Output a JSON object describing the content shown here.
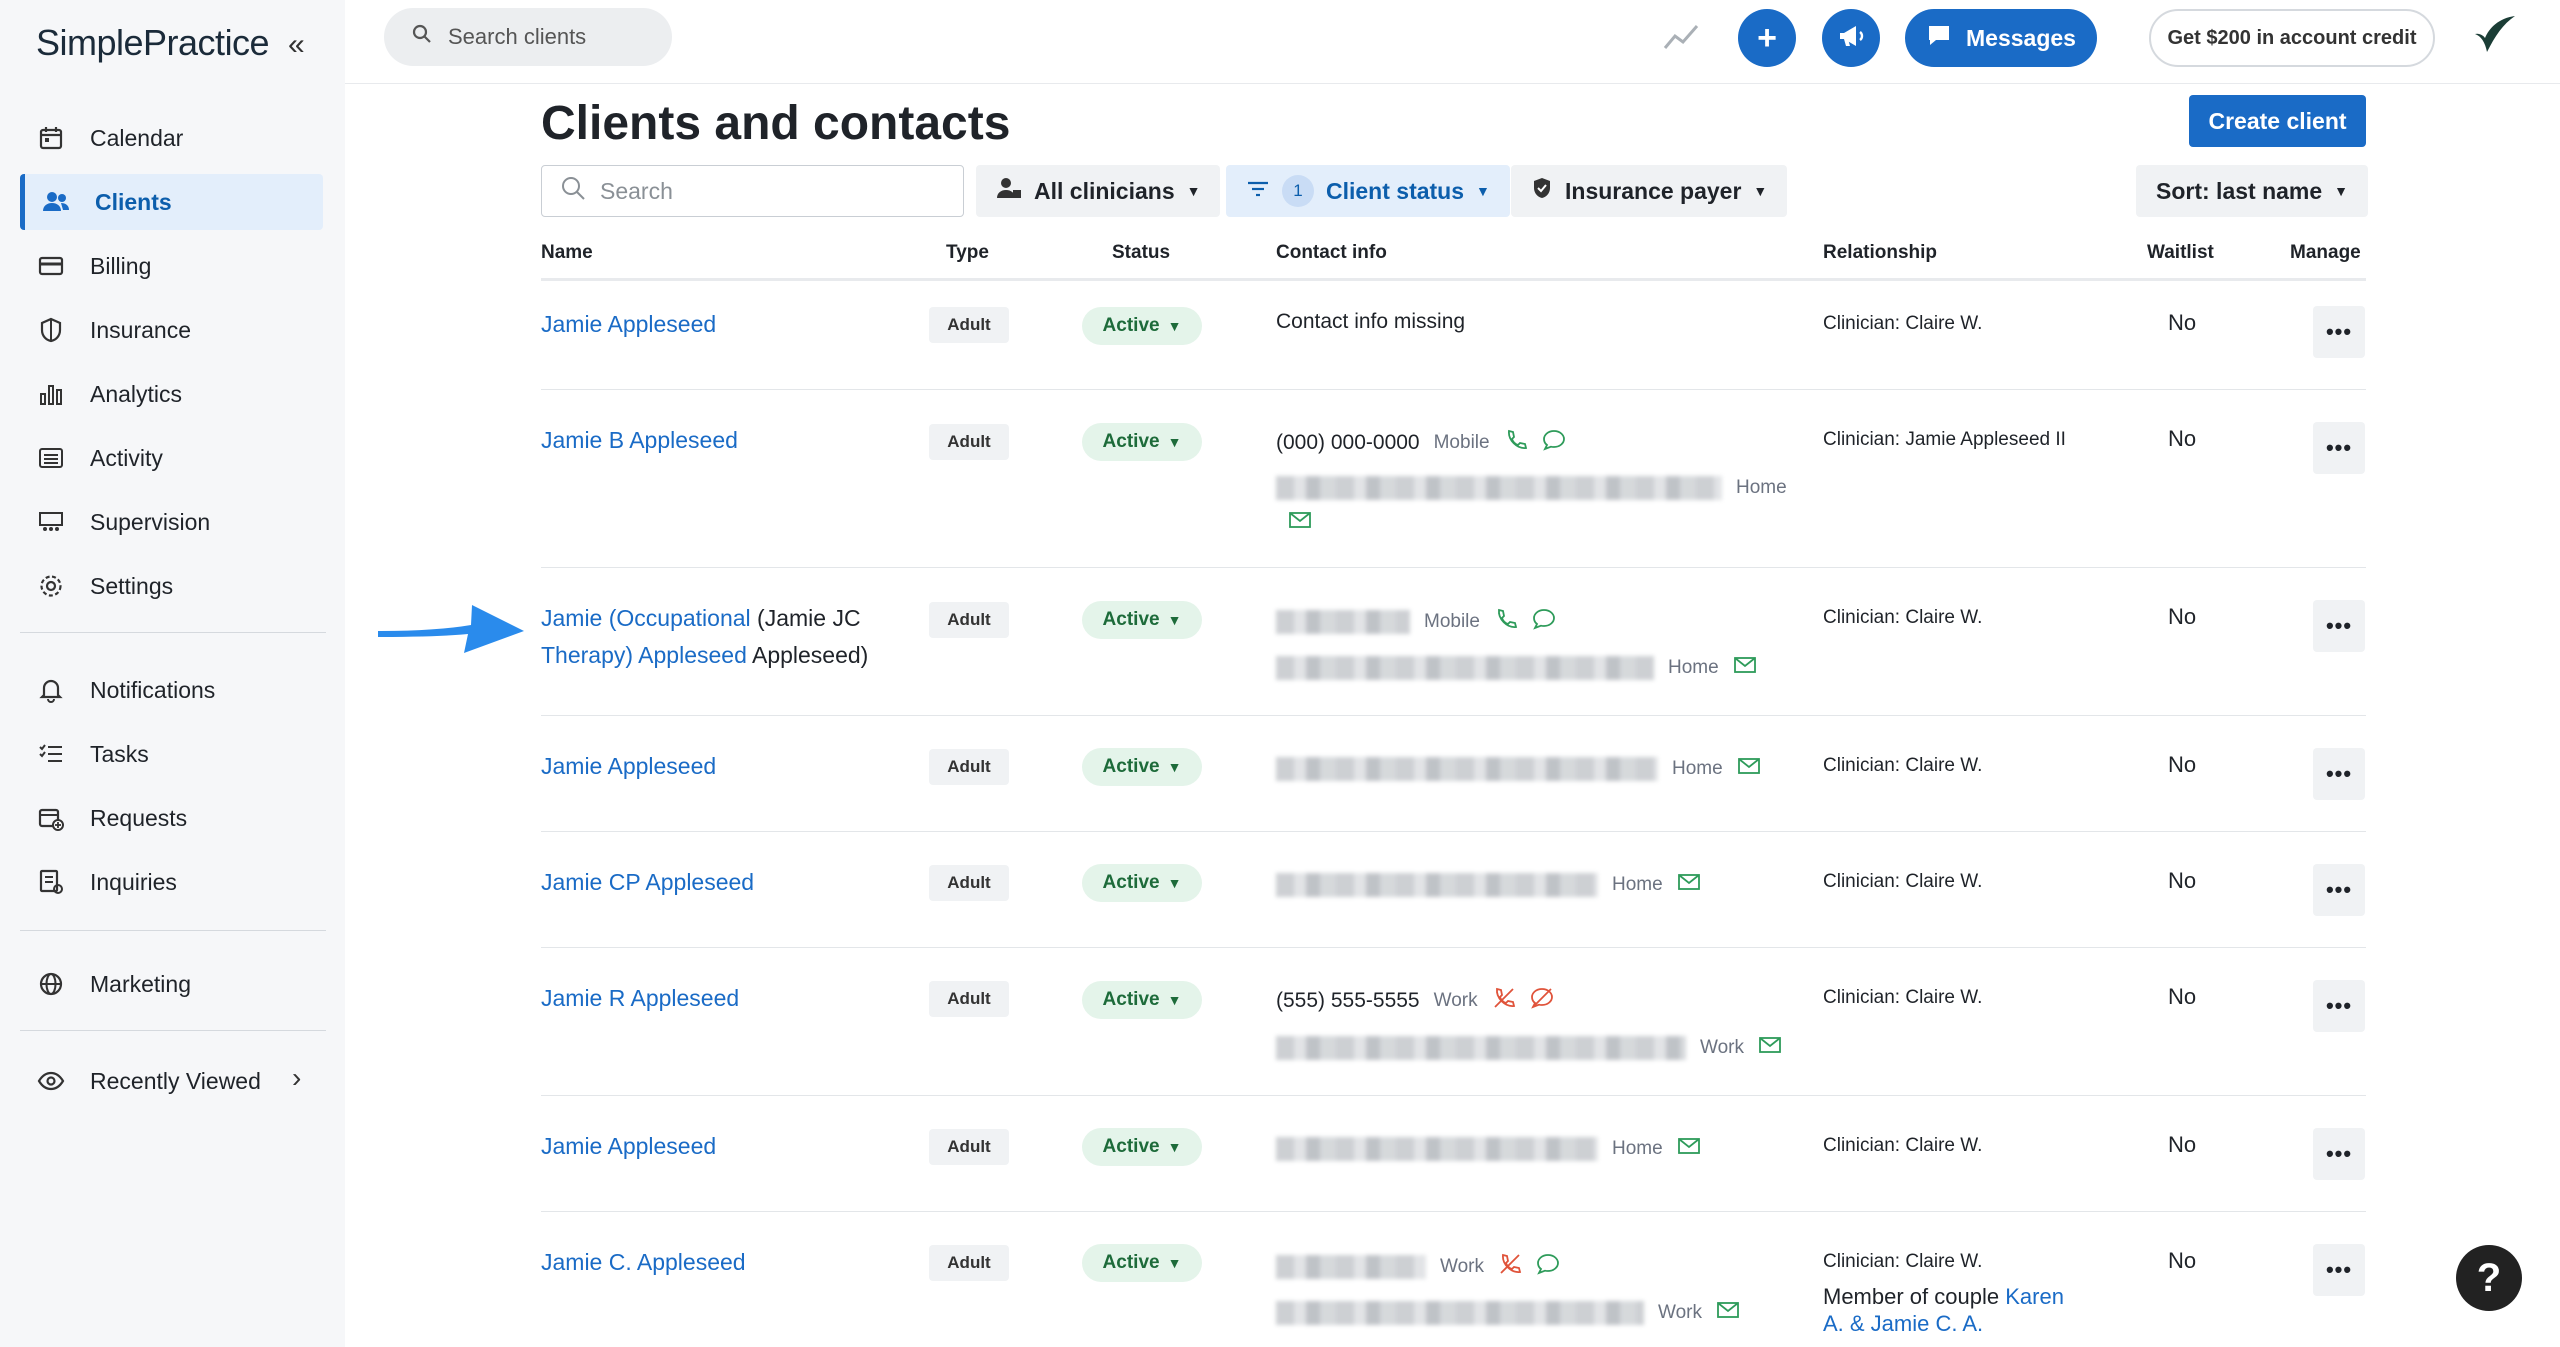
{
  "app": {
    "logo": "SimplePractice"
  },
  "sidebar": {
    "items": [
      {
        "label": "Calendar",
        "icon": "calendar-icon"
      },
      {
        "label": "Clients",
        "icon": "people-icon",
        "active": true
      },
      {
        "label": "Billing",
        "icon": "credit-card-icon"
      },
      {
        "label": "Insurance",
        "icon": "shield-icon"
      },
      {
        "label": "Analytics",
        "icon": "bar-chart-icon"
      },
      {
        "label": "Activity",
        "icon": "list-icon"
      },
      {
        "label": "Supervision",
        "icon": "supervision-icon"
      },
      {
        "label": "Settings",
        "icon": "gear-icon"
      }
    ],
    "items2": [
      {
        "label": "Notifications",
        "icon": "bell-icon"
      },
      {
        "label": "Tasks",
        "icon": "tasks-icon"
      },
      {
        "label": "Requests",
        "icon": "calendar-plus-icon"
      },
      {
        "label": "Inquiries",
        "icon": "inquiries-icon"
      }
    ],
    "marketing": "Marketing",
    "recently_viewed": "Recently Viewed"
  },
  "topbar": {
    "search_placeholder": "Search clients",
    "messages_label": "Messages",
    "credit_label": "Get $200 in account credit"
  },
  "page": {
    "title": "Clients and contacts",
    "create_label": "Create client",
    "search_placeholder": "Search",
    "filters": {
      "clinicians": "All clinicians",
      "status_count": "1",
      "status": "Client status",
      "insurance": "Insurance payer",
      "sort": "Sort: last name"
    }
  },
  "table": {
    "headers": {
      "name": "Name",
      "type": "Type",
      "status": "Status",
      "contact": "Contact info",
      "relationship": "Relationship",
      "waitlist": "Waitlist",
      "manage": "Manage"
    },
    "rows": [
      {
        "name": "Jamie Appleseed",
        "type": "Adult",
        "status": "Active",
        "contact_text": "Contact info missing",
        "relationship": "Clinician: Claire W.",
        "waitlist": "No"
      },
      {
        "name": "Jamie B Appleseed",
        "type": "Adult",
        "status": "Active",
        "phone": "(000) 000-0000",
        "phone_label": "Mobile",
        "email_label": "Home",
        "relationship": "Clinician: Jamie Appleseed II",
        "waitlist": "No"
      },
      {
        "name_link_1": "Jamie (Occupational",
        "name_plain_1": "(Jamie JC",
        "name_link_2": "Therapy) Appleseed",
        "name_plain_2": "Appleseed)",
        "type": "Adult",
        "status": "Active",
        "phone_label": "Mobile",
        "email_label": "Home",
        "relationship": "Clinician: Claire W.",
        "waitlist": "No"
      },
      {
        "name": "Jamie Appleseed",
        "type": "Adult",
        "status": "Active",
        "email_label": "Home",
        "relationship": "Clinician: Claire W.",
        "waitlist": "No"
      },
      {
        "name": "Jamie CP Appleseed",
        "type": "Adult",
        "status": "Active",
        "email_label": "Home",
        "relationship": "Clinician: Claire W.",
        "waitlist": "No"
      },
      {
        "name": "Jamie R Appleseed",
        "type": "Adult",
        "status": "Active",
        "phone": "(555) 555-5555",
        "phone_label": "Work",
        "email_label": "Work",
        "relationship": "Clinician: Claire W.",
        "waitlist": "No"
      },
      {
        "name": "Jamie Appleseed",
        "type": "Adult",
        "status": "Active",
        "email_label": "Home",
        "relationship": "Clinician: Claire W.",
        "waitlist": "No"
      },
      {
        "name": "Jamie C. Appleseed",
        "type": "Adult",
        "status": "Active",
        "phone_label": "Work",
        "email_label": "Work",
        "relationship": "Clinician: Claire W.",
        "member_prefix": "Member of couple",
        "member_link_1": "Karen",
        "member_link_2": "A. & Jamie C. A.",
        "waitlist": "No"
      }
    ],
    "manage_label": "•••"
  },
  "help_label": "?"
}
